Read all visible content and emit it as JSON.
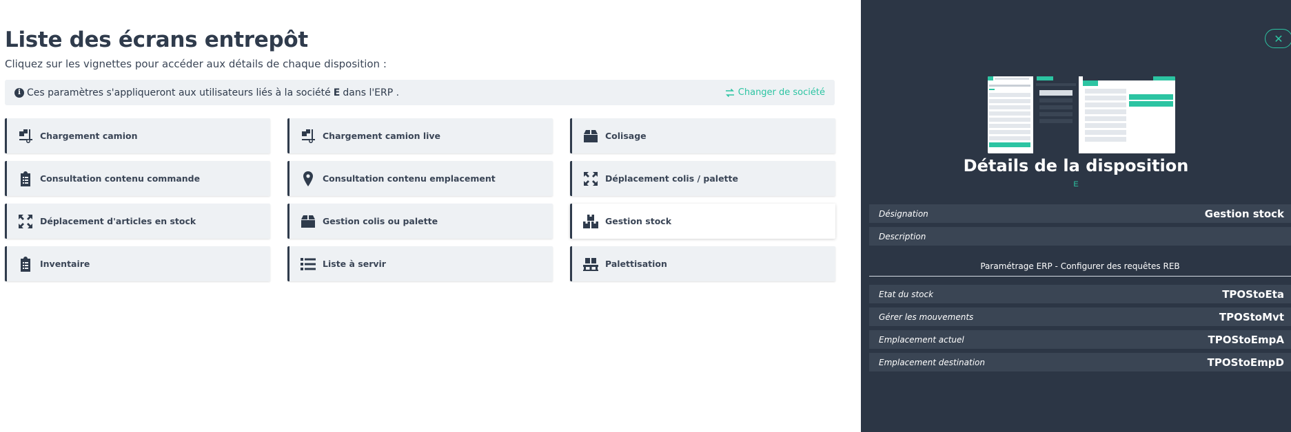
{
  "main": {
    "title": "Liste des écrans entrepôt",
    "subtitle": "Cliquez sur les vignettes pour accéder aux détails de chaque disposition :",
    "info": {
      "prefix": "Ces paramètres s'appliqueront aux utilisateurs liés à la société",
      "company": "E",
      "suffix": "dans l'ERP .",
      "change_label": "Changer de société"
    },
    "tiles": [
      {
        "label": "Chargement camion",
        "icon": "truck-loading-icon"
      },
      {
        "label": "Chargement camion live",
        "icon": "truck-loading-icon"
      },
      {
        "label": "Colisage",
        "icon": "box-icon"
      },
      {
        "label": "Consultation contenu commande",
        "icon": "clipboard-list-icon"
      },
      {
        "label": "Consultation contenu emplacement",
        "icon": "map-marker-icon"
      },
      {
        "label": "Déplacement colis / palette",
        "icon": "arrows-expand-icon"
      },
      {
        "label": "Déplacement d'articles en stock",
        "icon": "arrows-expand-icon"
      },
      {
        "label": "Gestion colis ou palette",
        "icon": "box-icon"
      },
      {
        "label": "Gestion stock",
        "icon": "boxes-icon"
      },
      {
        "label": "Inventaire",
        "icon": "clipboard-list-icon"
      },
      {
        "label": "Liste à servir",
        "icon": "list-icon"
      },
      {
        "label": "Palettisation",
        "icon": "pallet-icon"
      }
    ]
  },
  "panel": {
    "close_label": "✕",
    "title": "Détails de la disposition",
    "company": "E",
    "designation_key": "Désignation",
    "designation_value": "Gestion stock",
    "description_key": "Description",
    "description_value": "",
    "section_title": "Paramétrage ERP - Configurer des requêtes REB",
    "params": [
      {
        "key": "Etat du stock",
        "value": "TPOStoEta"
      },
      {
        "key": "Gérer les mouvements",
        "value": "TPOStoMvt"
      },
      {
        "key": "Emplacement actuel",
        "value": "TPOStoEmpA"
      },
      {
        "key": "Emplacement destination",
        "value": "TPOStoEmpD"
      }
    ]
  },
  "colors": {
    "accent": "#2cc4a2",
    "dark": "#2c3645",
    "tile_bg": "#eef1f4"
  }
}
